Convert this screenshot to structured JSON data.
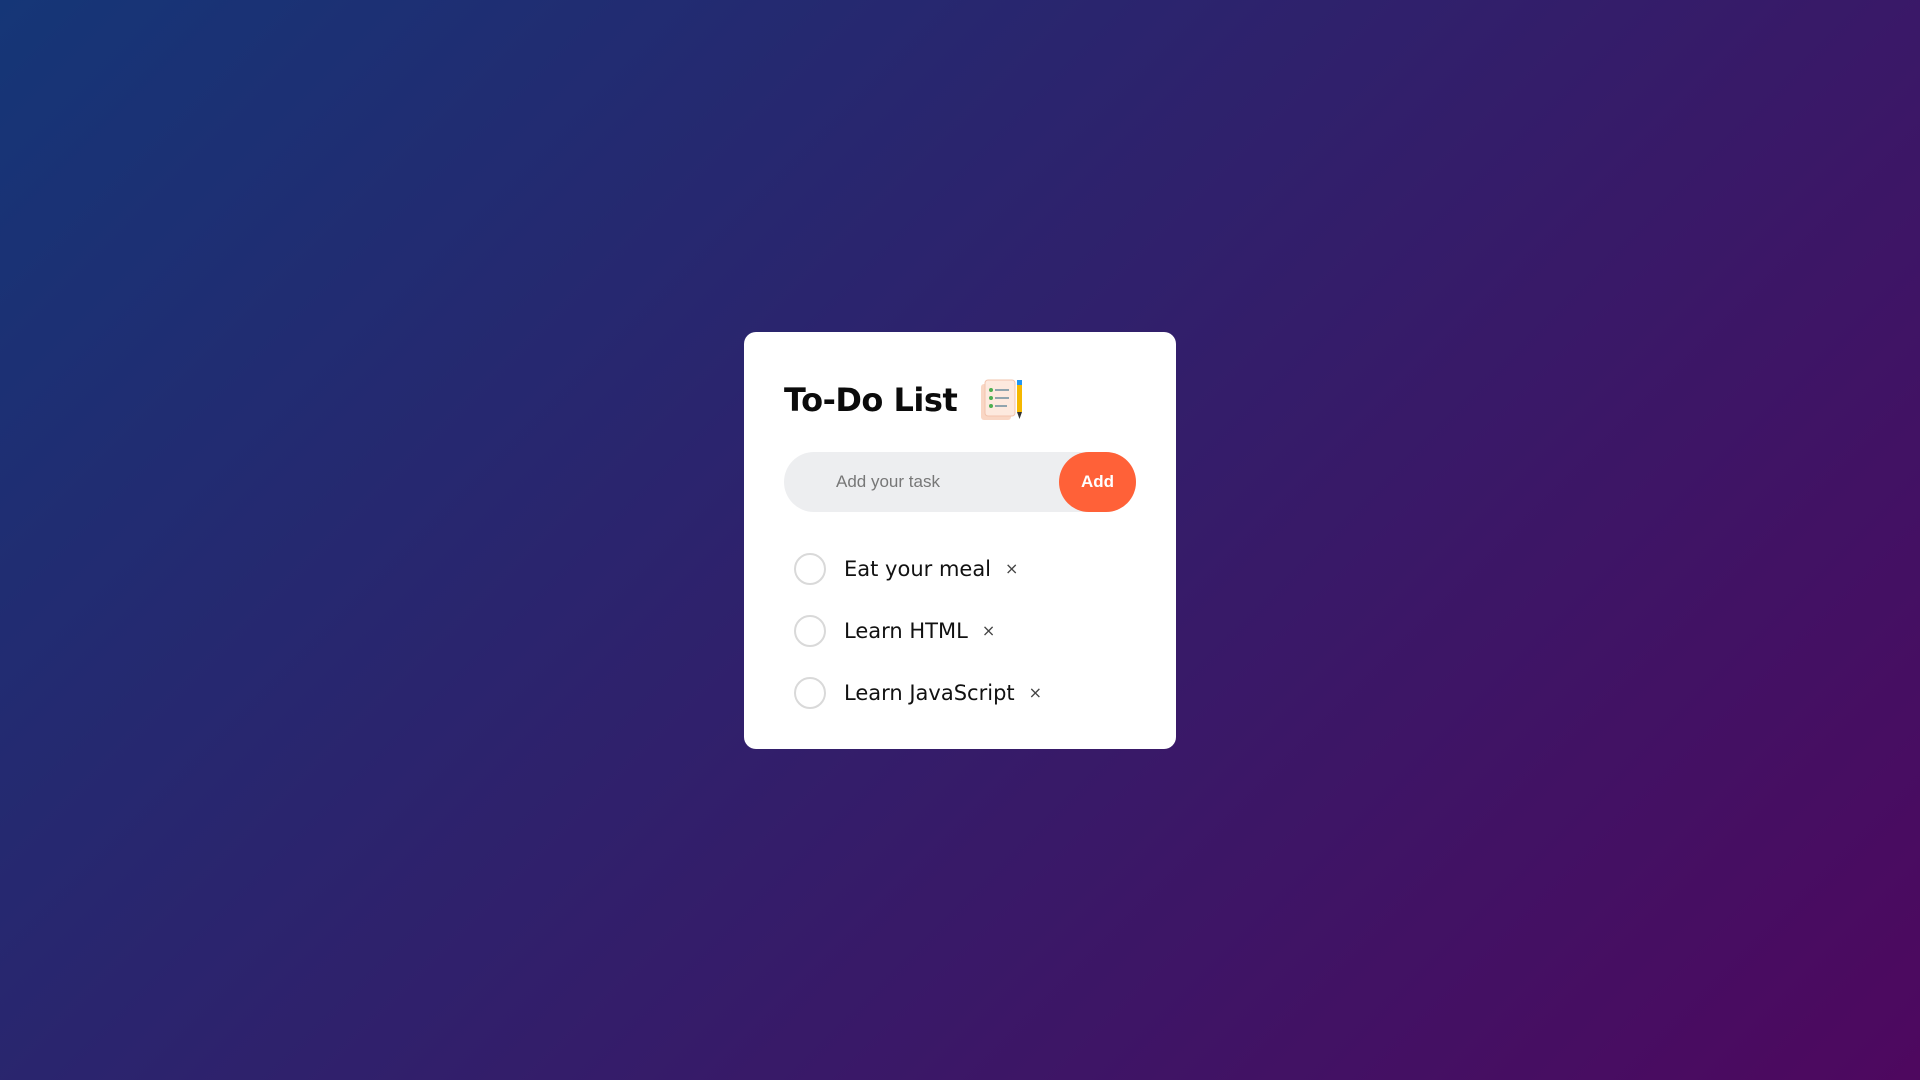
{
  "app": {
    "title": "To-Do List",
    "title_icon": "notepad-pencil-icon"
  },
  "input": {
    "placeholder": "Add your task",
    "value": "",
    "add_label": "Add"
  },
  "tasks": [
    {
      "label": "Eat your meal",
      "checked": false,
      "remove_icon": "×"
    },
    {
      "label": "Learn HTML",
      "checked": false,
      "remove_icon": "×"
    },
    {
      "label": "Learn JavaScript",
      "checked": false,
      "remove_icon": "×"
    }
  ],
  "colors": {
    "background_start": "#153677",
    "background_end": "#4e085f",
    "accent": "#ff6138",
    "input_bg": "#edeef0"
  }
}
